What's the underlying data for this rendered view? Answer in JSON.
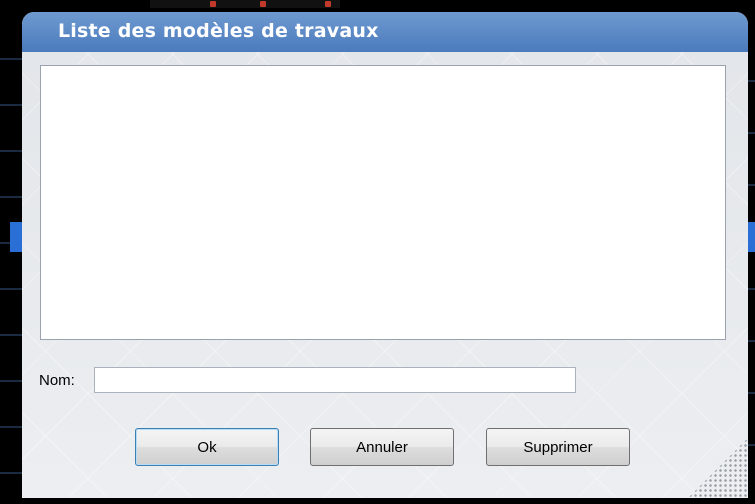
{
  "dialog": {
    "title": "Liste des modèles de travaux",
    "list_items": [],
    "name_field": {
      "label": "Nom:",
      "value": ""
    },
    "buttons": {
      "ok": "Ok",
      "cancel": "Annuler",
      "delete": "Supprimer"
    }
  },
  "colors": {
    "titlebar": "#5d8ac7",
    "title_text": "#ffffff",
    "dialog_body": "#e6e8eb",
    "screen_background": "#000000"
  }
}
